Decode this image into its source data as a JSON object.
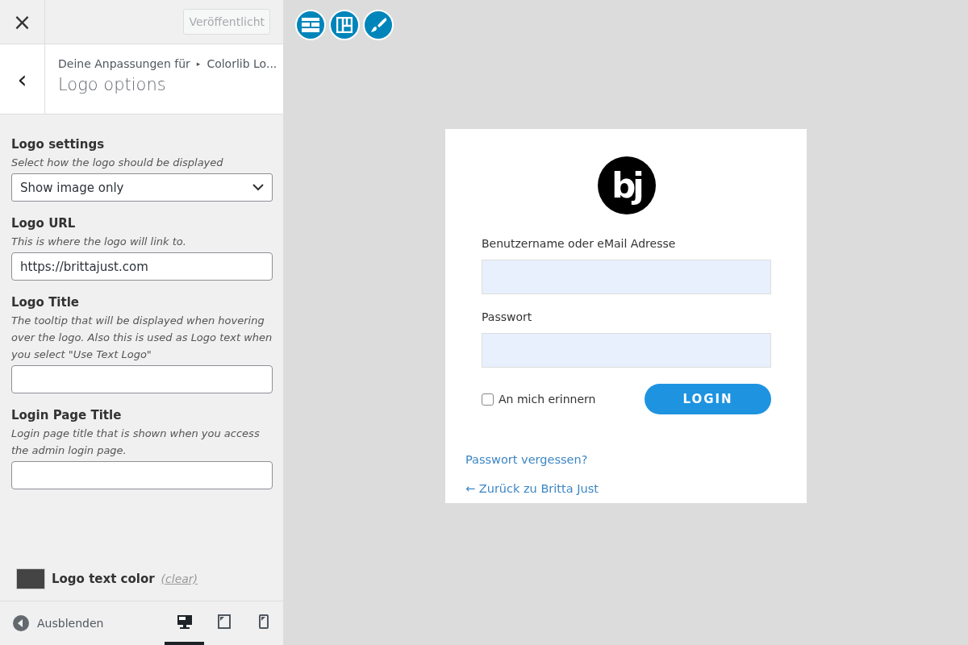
{
  "header": {
    "close": "×",
    "publish_button": "Veröffentlicht"
  },
  "section": {
    "back": "‹",
    "breadcrumb_prefix": "Deine Anpassungen für",
    "breadcrumb_sep": "▸",
    "breadcrumb_current": "Colorlib Lo...",
    "title": "Logo options"
  },
  "fields": [
    {
      "kind": "select",
      "label": "Logo settings",
      "description": "Select how the logo should be displayed",
      "selected_option": "Show image only"
    },
    {
      "kind": "text",
      "label": "Logo URL",
      "description": "This is where the logo will link to.",
      "input_text": "https://brittajust.com"
    },
    {
      "kind": "text",
      "label": "Logo Title",
      "description": "The tooltip that will be displayed when hovering over the logo. Also this is used as Logo text when you select \"Use Text Logo\""
    },
    {
      "kind": "text",
      "label": "Login Page Title",
      "description": "Login page title that is shown when you access the admin login page."
    }
  ],
  "color_setting": {
    "label": "Logo text color",
    "clear": "(clear)",
    "color": "#444444"
  },
  "footer": {
    "hide": "Ausblenden",
    "devices": [
      {
        "selected": true
      },
      {
        "selected": false
      },
      {
        "selected": false
      }
    ]
  },
  "preview": {
    "login": {
      "logo_text": "bj",
      "username_label": "Benutzername oder eMail Adresse",
      "password_label": "Passwort",
      "remember": {
        "label": "An mich erinnern",
        "checked": false
      },
      "button": "LOGIN",
      "links": [
        "Passwort vergessen?",
        "← Zurück zu Britta Just"
      ]
    }
  }
}
